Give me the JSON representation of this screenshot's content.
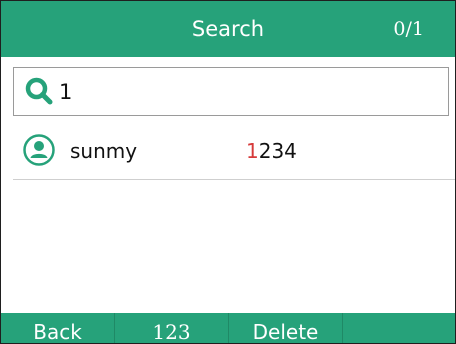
{
  "header": {
    "title": "Search",
    "counter": "0/1"
  },
  "search": {
    "value": "1",
    "icon": "search-icon"
  },
  "results": [
    {
      "name": "sunmy",
      "number_match": "1",
      "number_rest": "234",
      "icon": "contact-avatar-icon"
    }
  ],
  "softkeys": {
    "back": "Back",
    "mode": "123",
    "delete": "Delete",
    "empty": ""
  },
  "colors": {
    "accent": "#26a27a",
    "match_highlight": "#d63a3a"
  }
}
